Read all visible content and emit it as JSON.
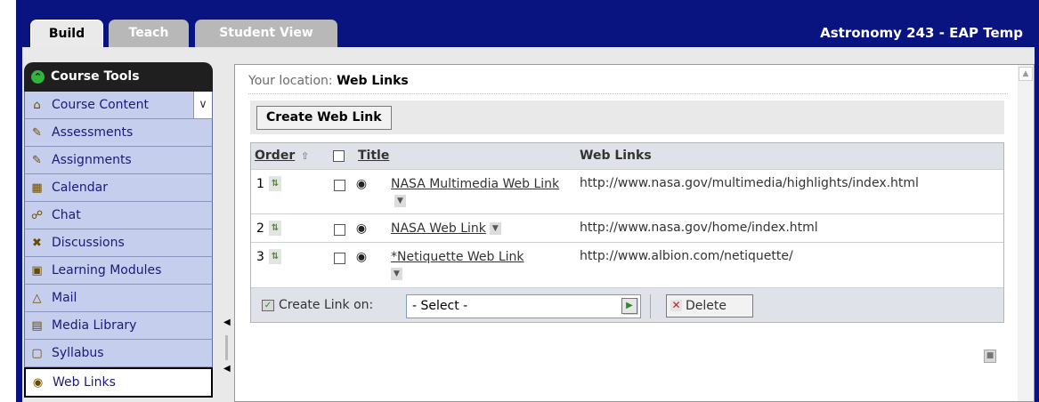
{
  "tabs": [
    {
      "label": "Build"
    },
    {
      "label": "Teach"
    },
    {
      "label": "Student View"
    }
  ],
  "course_title": "Astronomy 243 - EAP Temp",
  "sidebar": {
    "header": "Course Tools",
    "items": [
      {
        "label": "Course Content",
        "icon": "home-icon"
      },
      {
        "label": "Assessments",
        "icon": "clipboard-icon"
      },
      {
        "label": "Assignments",
        "icon": "document-icon"
      },
      {
        "label": "Calendar",
        "icon": "calendar-icon"
      },
      {
        "label": "Chat",
        "icon": "chat-bubble-icon"
      },
      {
        "label": "Discussions",
        "icon": "pin-icon"
      },
      {
        "label": "Learning Modules",
        "icon": "module-icon"
      },
      {
        "label": "Mail",
        "icon": "mail-tray-icon"
      },
      {
        "label": "Media Library",
        "icon": "media-icon"
      },
      {
        "label": "Syllabus",
        "icon": "syllabus-icon"
      },
      {
        "label": "Web Links",
        "icon": "globe-icon"
      }
    ]
  },
  "main": {
    "location_label": "Your location:",
    "location_value": "Web Links",
    "create_button": "Create Web Link",
    "table": {
      "headers": {
        "order": "Order",
        "title": "Title",
        "links": "Web Links"
      },
      "rows": [
        {
          "order": "1",
          "title": "NASA Multimedia Web Link",
          "url": "http://www.nasa.gov/multimedia/highlights/index.html"
        },
        {
          "order": "2",
          "title": "NASA Web Link",
          "url": "http://www.nasa.gov/home/index.html"
        },
        {
          "order": "3",
          "title": "*Netiquette Web Link",
          "url": "http://www.albion.com/netiquette/"
        }
      ]
    },
    "footer": {
      "create_link_label": "Create Link on:",
      "select_value": "- Select -",
      "delete_label": "Delete"
    }
  }
}
